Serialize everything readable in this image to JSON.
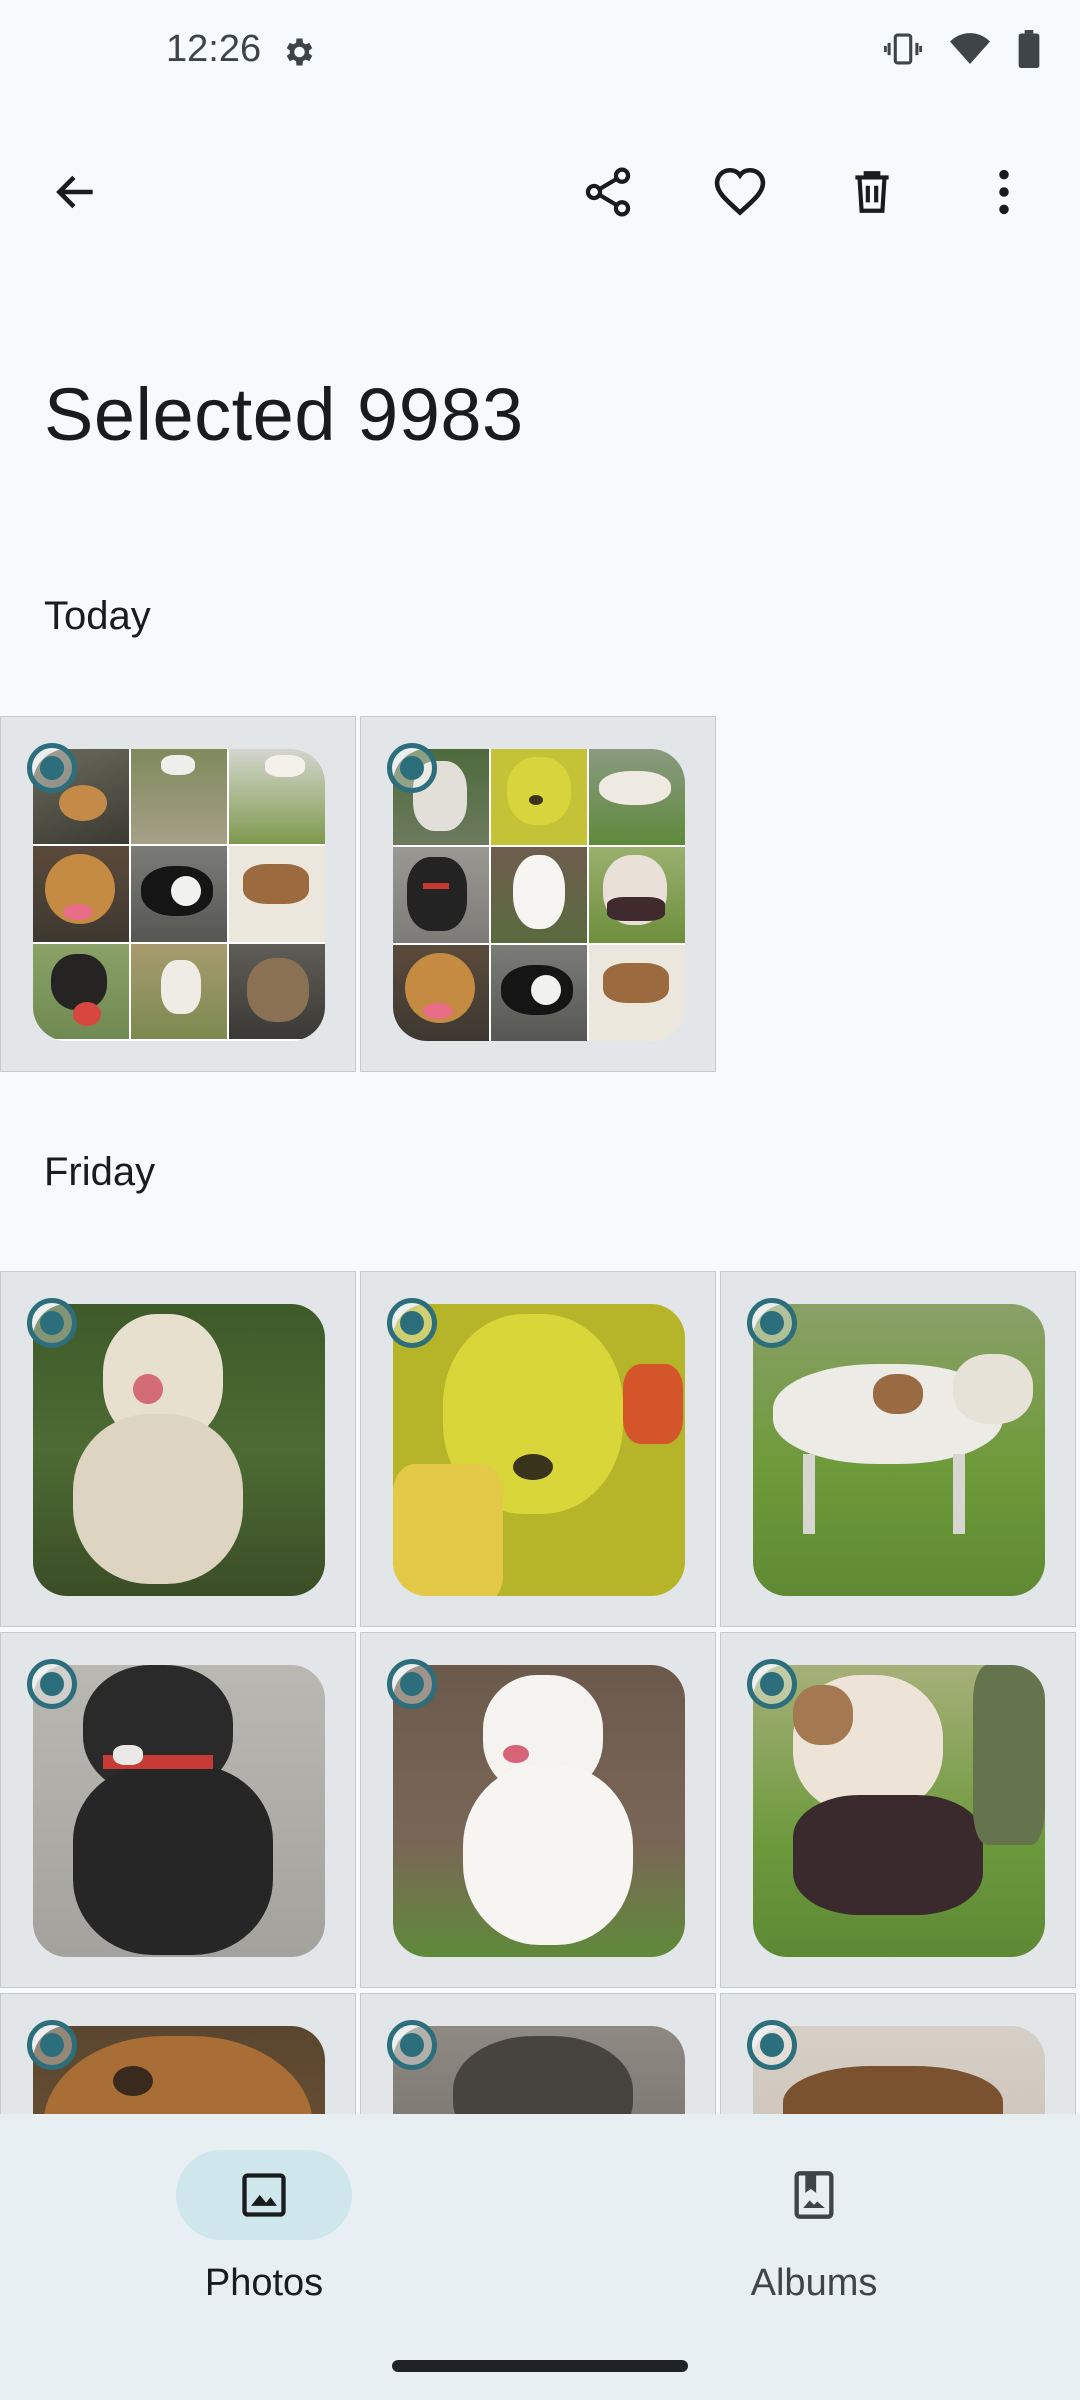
{
  "status": {
    "time": "12:26"
  },
  "toolbar": {
    "back_icon": "arrow-back-icon",
    "share_icon": "share-icon",
    "favorite_icon": "heart-icon",
    "delete_icon": "trash-icon",
    "more_icon": "more-vert-icon"
  },
  "title": "Selected 9983",
  "sections": [
    {
      "label": "Today"
    },
    {
      "label": "Friday"
    }
  ],
  "nav": {
    "photos_label": "Photos",
    "albums_label": "Albums",
    "active": "Photos"
  },
  "colors": {
    "accent": "#2c6e7b",
    "background": "#f6fafd",
    "nav_background": "#e8eff2",
    "active_pill": "#cfe6ec"
  }
}
